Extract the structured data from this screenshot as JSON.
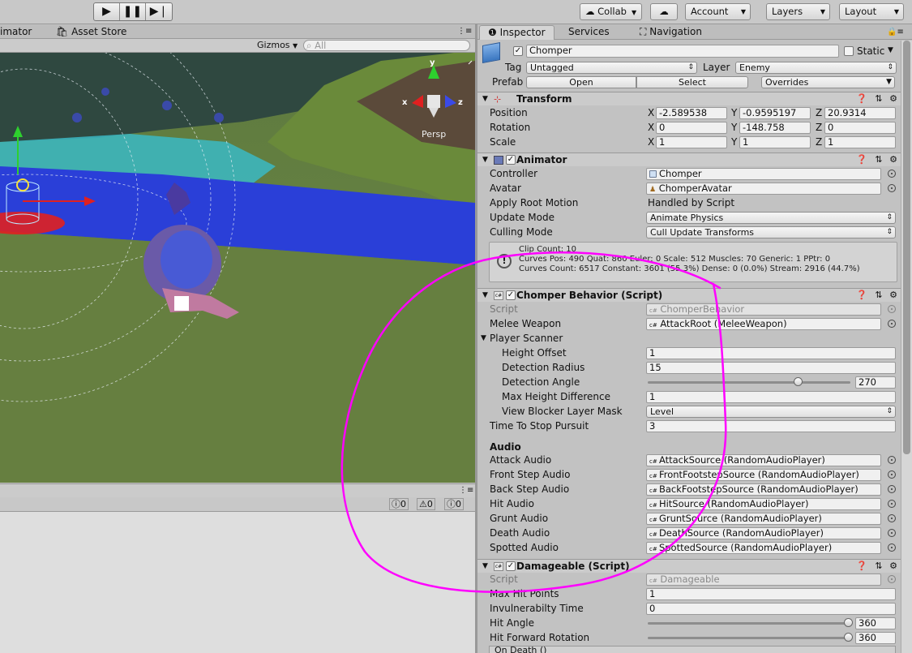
{
  "toolbar": {
    "collab": "Collab",
    "account": "Account",
    "layers": "Layers",
    "layout": "Layout"
  },
  "left_tabs": {
    "animator": "imator",
    "asset_store": "Asset Store"
  },
  "scene_bar": {
    "gizmos": "Gizmos",
    "search_placeholder": "All"
  },
  "scene": {
    "persp": "Persp",
    "gizmo_y": "y",
    "gizmo_z": "z",
    "gizmo_x": "x"
  },
  "console": {
    "errors": "0",
    "warnings": "0",
    "messages": "0"
  },
  "inspector": {
    "tabs": [
      "Inspector",
      "Services",
      "Navigation"
    ],
    "object": {
      "name": "Chomper",
      "static_label": "Static",
      "tag_label": "Tag",
      "tag_value": "Untagged",
      "layer_label": "Layer",
      "layer_value": "Enemy",
      "prefab_label": "Prefab",
      "open": "Open",
      "select": "Select",
      "overrides": "Overrides"
    },
    "transform": {
      "title": "Transform",
      "position_label": "Position",
      "rotation_label": "Rotation",
      "scale_label": "Scale",
      "x": "X",
      "y": "Y",
      "z": "Z",
      "position": [
        "-2.589538",
        "-0.9595197",
        "20.9314"
      ],
      "rotation": [
        "0",
        "-148.758",
        "0"
      ],
      "scale": [
        "1",
        "1",
        "1"
      ]
    },
    "animator": {
      "title": "Animator",
      "controller_label": "Controller",
      "controller_value": "Chomper",
      "avatar_label": "Avatar",
      "avatar_value": "ChomperAvatar",
      "root_motion_label": "Apply Root Motion",
      "root_motion_value": "Handled by Script",
      "update_mode_label": "Update Mode",
      "update_mode_value": "Animate Physics",
      "culling_mode_label": "Culling Mode",
      "culling_mode_value": "Cull Update Transforms",
      "info_line1": "Clip Count: 10",
      "info_line2": "Curves Pos: 490 Quat: 860 Euler: 0 Scale: 512 Muscles: 70 Generic: 1 PPtr: 0",
      "info_line3": "Curves Count: 6517 Constant: 3601 (55.3%) Dense: 0 (0.0%) Stream: 2916 (44.7%)"
    },
    "chomper": {
      "title": "Chomper Behavior (Script)",
      "script_label": "Script",
      "script_value": "ChomperBehavior",
      "melee_label": "Melee Weapon",
      "melee_value": "AttackRoot (MeleeWeapon)",
      "scanner_label": "Player Scanner",
      "height_offset_label": "Height Offset",
      "height_offset_value": "1",
      "detection_radius_label": "Detection Radius",
      "detection_radius_value": "15",
      "detection_angle_label": "Detection Angle",
      "detection_angle_value": "270",
      "max_height_label": "Max Height Difference",
      "max_height_value": "1",
      "blocker_label": "View Blocker Layer Mask",
      "blocker_value": "Level",
      "pursuit_label": "Time To Stop Pursuit",
      "pursuit_value": "3",
      "audio_heading": "Audio",
      "audio": [
        {
          "label": "Attack Audio",
          "value": "AttackSource (RandomAudioPlayer)"
        },
        {
          "label": "Front Step Audio",
          "value": "FrontFootstepSource (RandomAudioPlayer)"
        },
        {
          "label": "Back Step Audio",
          "value": "BackFootstepSource (RandomAudioPlayer)"
        },
        {
          "label": "Hit Audio",
          "value": "HitSource (RandomAudioPlayer)"
        },
        {
          "label": "Grunt Audio",
          "value": "GruntSource (RandomAudioPlayer)"
        },
        {
          "label": "Death Audio",
          "value": "DeathSource (RandomAudioPlayer)"
        },
        {
          "label": "Spotted Audio",
          "value": "SpottedSource (RandomAudioPlayer)"
        }
      ]
    },
    "damageable": {
      "title": "Damageable (Script)",
      "script_label": "Script",
      "script_value": "Damageable",
      "max_hp_label": "Max Hit Points",
      "max_hp_value": "1",
      "invuln_label": "Invulnerabilty Time",
      "invuln_value": "0",
      "hit_angle_label": "Hit Angle",
      "hit_angle_value": "360",
      "hit_fwd_label": "Hit Forward Rotation",
      "hit_fwd_value": "360",
      "on_death": "On Death ()"
    }
  },
  "colors": {
    "annotation": "#ff00ff",
    "water": "#2a3fd8",
    "terrain": "#5a7a3c"
  }
}
